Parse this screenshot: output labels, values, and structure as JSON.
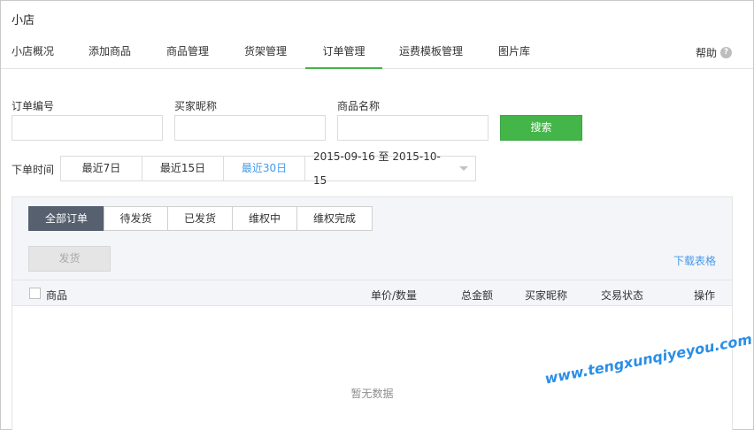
{
  "app": {
    "title": "小店"
  },
  "nav": {
    "items": [
      {
        "label": "小店概况"
      },
      {
        "label": "添加商品"
      },
      {
        "label": "商品管理"
      },
      {
        "label": "货架管理"
      },
      {
        "label": "订单管理"
      },
      {
        "label": "运费模板管理"
      },
      {
        "label": "图片库"
      }
    ],
    "active": "订单管理",
    "help_label": "帮助",
    "help_icon": "question-circle-icon",
    "accent_color": "#44b549"
  },
  "filters": {
    "order_no_label": "订单编号",
    "order_no_value": "",
    "buyer_label": "买家昵称",
    "buyer_value": "",
    "product_label": "商品名称",
    "product_value": "",
    "search_label": "搜索",
    "time_label": "下单时间",
    "time_options": [
      {
        "label": "最近7日"
      },
      {
        "label": "最近15日"
      },
      {
        "label": "最近30日"
      }
    ],
    "time_active": "最近30日",
    "date_range": "2015-09-16 至 2015-10-15",
    "date_icon": "caret-down-icon"
  },
  "orders": {
    "tabs": [
      {
        "label": "全部订单"
      },
      {
        "label": "待发货"
      },
      {
        "label": "已发货"
      },
      {
        "label": "维权中"
      },
      {
        "label": "维权完成"
      }
    ],
    "active_tab": "全部订单",
    "ship_label": "发货",
    "download_label": "下载表格",
    "columns": [
      "商品",
      "单价/数量",
      "总金额",
      "买家昵称",
      "交易状态",
      "操作"
    ],
    "empty_text": "暂无数据"
  },
  "watermark": "www.tengxunqiyeyou.com"
}
